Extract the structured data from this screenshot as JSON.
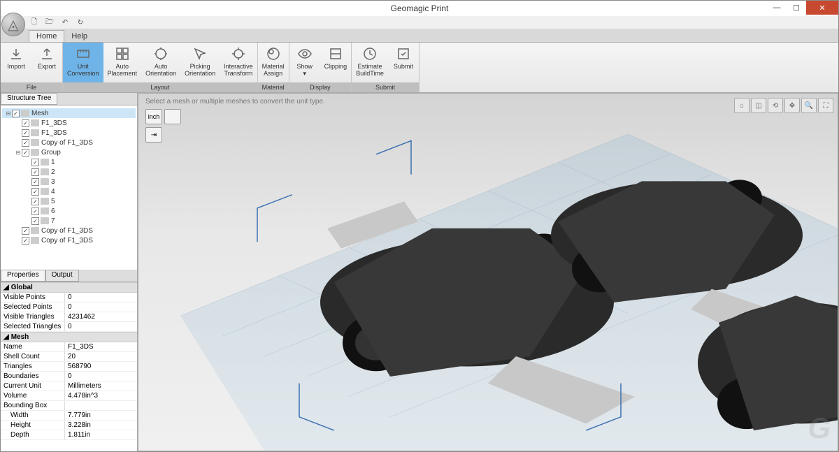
{
  "app": {
    "title": "Geomagic Print"
  },
  "menu": {
    "tabs": [
      "Home",
      "Help"
    ],
    "active": 0
  },
  "ribbon": {
    "groups": [
      {
        "label": "File",
        "buttons": [
          {
            "name": "import",
            "label": "Import",
            "icon": "import"
          },
          {
            "name": "export",
            "label": "Export",
            "icon": "export"
          }
        ]
      },
      {
        "label": "Layout",
        "buttons": [
          {
            "name": "unit-conversion",
            "label": "Unit\nConversion",
            "icon": "unit",
            "active": true
          },
          {
            "name": "auto-placement",
            "label": "Auto\nPlacement",
            "icon": "autoplace"
          },
          {
            "name": "auto-orientation",
            "label": "Auto\nOrientation",
            "icon": "autoorient"
          },
          {
            "name": "picking-orientation",
            "label": "Picking\nOrientation",
            "icon": "pick"
          },
          {
            "name": "interactive-transform",
            "label": "Interactive\nTransform",
            "icon": "transform"
          }
        ]
      },
      {
        "label": "Material",
        "buttons": [
          {
            "name": "material-assign",
            "label": "Material\nAssign",
            "icon": "material"
          }
        ]
      },
      {
        "label": "Display",
        "buttons": [
          {
            "name": "show",
            "label": "Show\n▾",
            "icon": "show"
          },
          {
            "name": "clipping",
            "label": "Clipping",
            "icon": "clipping"
          }
        ]
      },
      {
        "label": "Submit",
        "buttons": [
          {
            "name": "estimate-buildtime",
            "label": "Estimate\nBuildTime",
            "icon": "clock"
          },
          {
            "name": "submit",
            "label": "Submit",
            "icon": "submit"
          }
        ]
      }
    ]
  },
  "structureTree": {
    "title": "Structure Tree",
    "root": {
      "label": "Mesh",
      "selected": true
    },
    "items": [
      {
        "label": "F1_3DS",
        "indent": 1
      },
      {
        "label": "F1_3DS",
        "indent": 1
      },
      {
        "label": "Copy of F1_3DS",
        "indent": 1
      },
      {
        "label": "Group",
        "indent": 1,
        "expandable": true
      },
      {
        "label": "1",
        "indent": 2
      },
      {
        "label": "2",
        "indent": 2
      },
      {
        "label": "3",
        "indent": 2
      },
      {
        "label": "4",
        "indent": 2
      },
      {
        "label": "5",
        "indent": 2
      },
      {
        "label": "6",
        "indent": 2
      },
      {
        "label": "7",
        "indent": 2
      },
      {
        "label": "Copy of F1_3DS",
        "indent": 1
      },
      {
        "label": "Copy of F1_3DS",
        "indent": 1
      }
    ]
  },
  "propsPanel": {
    "tabs": [
      "Properties",
      "Output"
    ],
    "sections": [
      {
        "title": "Global",
        "rows": [
          {
            "k": "Visible Points",
            "v": "0"
          },
          {
            "k": "Selected Points",
            "v": "0"
          },
          {
            "k": "Visible Triangles",
            "v": "4231462"
          },
          {
            "k": "Selected Triangles",
            "v": "0"
          }
        ]
      },
      {
        "title": "Mesh",
        "rows": [
          {
            "k": "Name",
            "v": "F1_3DS"
          },
          {
            "k": "Shell Count",
            "v": "20"
          },
          {
            "k": "Triangles",
            "v": "568790"
          },
          {
            "k": "Boundaries",
            "v": "0"
          },
          {
            "k": "Current Unit",
            "v": "Millimeters"
          },
          {
            "k": "Volume",
            "v": "4.478in^3"
          },
          {
            "k": "Bounding Box",
            "v": ""
          },
          {
            "k": "Width",
            "v": "7.779in",
            "indent": true
          },
          {
            "k": "Height",
            "v": "3.228in",
            "indent": true
          },
          {
            "k": "Depth",
            "v": "1.811in",
            "indent": true
          }
        ]
      }
    ]
  },
  "viewport": {
    "hint": "Select a mesh or multiple meshes to convert the unit type.",
    "unitButtons": [
      "inch",
      ""
    ],
    "convertLabel": "⇥"
  }
}
